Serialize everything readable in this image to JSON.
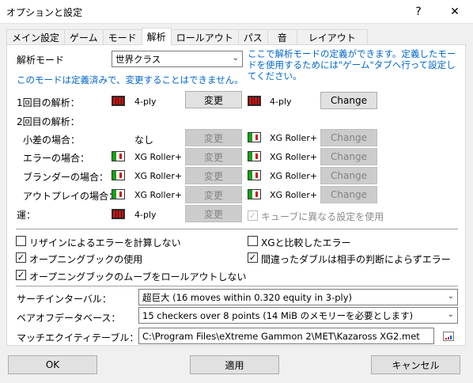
{
  "window": {
    "title": "オプションと設定",
    "help_icon": "?",
    "close_icon": "✕"
  },
  "tabs": [
    {
      "label": "メイン設定"
    },
    {
      "label": "ゲーム"
    },
    {
      "label": "モード"
    },
    {
      "label": "解析"
    },
    {
      "label": "ロールアウト"
    },
    {
      "label": "パス"
    },
    {
      "label": "音"
    },
    {
      "label": "レイアウト"
    }
  ],
  "active_tab": "解析",
  "analysis": {
    "mode_label": "解析モード",
    "mode_value": "世界クラス",
    "mode_hint": "ここで解析モードの定義ができます。定義したモードを使用するためには\"ゲーム\"タブへ行って設定してください。",
    "mode_note": "このモードは定義済みで、変更することはできません。",
    "first_label": "1回目の解析：",
    "second_label": "2回目の解析：",
    "luck_label": "運：",
    "rows": [
      {
        "label": "1回目の解析：",
        "left_icon": "red-checkers-icon",
        "left_value": "4-ply",
        "change1": "変更",
        "right_icon": "red-checkers-icon",
        "right_value": "4-ply",
        "change2": "Change"
      },
      {
        "label": "小差の場合：",
        "left_icon": "",
        "left_value": "なし",
        "change1": "変更",
        "right_icon": "xg-roller-icon",
        "right_value": "XG Roller+",
        "change2": "Change"
      },
      {
        "label": "エラーの場合：",
        "left_icon": "xg-roller-icon",
        "left_value": "XG Roller+",
        "change1": "変更",
        "right_icon": "xg-roller-icon",
        "right_value": "XG Roller+",
        "change2": "Change"
      },
      {
        "label": "ブランダーの場合：",
        "left_icon": "xg-roller-icon",
        "left_value": "XG Roller+",
        "change1": "変更",
        "right_icon": "xg-roller-icon",
        "right_value": "XG Roller+",
        "change2": "Change"
      },
      {
        "label": "アウトプレイの場合：",
        "left_icon": "xg-roller-icon",
        "left_value": "XG Roller+",
        "change1": "変更",
        "right_icon": "xg-roller-icon",
        "right_value": "XG Roller+",
        "change2": "Change"
      },
      {
        "label": "運：",
        "left_icon": "red-checkers-icon",
        "left_value": "4-ply",
        "change1": "変更"
      }
    ],
    "luck_checkbox": {
      "label": "キューブに異なる設定を使用",
      "checked": true,
      "disabled": true
    }
  },
  "checkboxes": [
    {
      "label": "リザインによるエラーを計算しない",
      "checked": false
    },
    {
      "label": "XGと比較したエラー",
      "checked": false
    },
    {
      "label": "オープニングブックの使用",
      "checked": true
    },
    {
      "label": "間違ったダブルは相手の判断によらずエラー",
      "checked": true
    },
    {
      "label": "オープニングブックのムーブをロールアウトしない",
      "checked": true
    }
  ],
  "search_interval": {
    "label": "サーチインターバル：",
    "value": "超巨大 (16 moves within 0.320 equity in 3-ply)"
  },
  "bearoff_db": {
    "label": "ベアオフデータベース：",
    "value": "15 checkers over 8 points (14 MiB のメモリーを必要とします)"
  },
  "match_equity": {
    "label": "マッチエクイティテーブル：",
    "value": "C:\\Program Files\\eXtreme Gammon 2\\MET\\Kazaross XG2.met"
  },
  "footer": {
    "ok": "OK",
    "apply": "適用",
    "cancel": "キャンセル"
  },
  "colors": {
    "link_blue": "#0066cc",
    "disabled_btn": "#cccccc",
    "checker_red": "#d01010",
    "xg_green": "#19a019"
  }
}
